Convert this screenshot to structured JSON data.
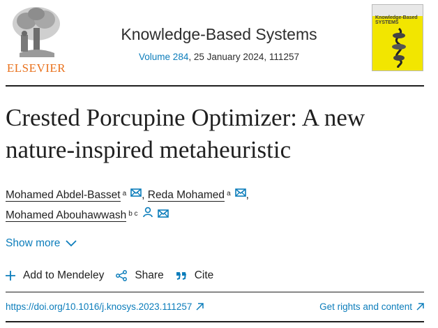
{
  "publisher": {
    "logo_text": "ELSEVIER",
    "logo_icon": "elsevier-tree-logo"
  },
  "journal": {
    "name": "Knowledge-Based Systems",
    "volume_link": "Volume 284",
    "issue_rest": ", 25 January 2024, 111257",
    "cover_title": "Knowledge-Based SYSTEMS"
  },
  "article": {
    "title": "Crested Porcupine Optimizer: A new nature-inspired metaheuristic",
    "authors": [
      {
        "name": "Mohamed Abdel-Basset",
        "sup": "a",
        "icons": [
          "mail-icon"
        ]
      },
      {
        "name": "Reda Mohamed",
        "sup": "a",
        "icons": [
          "mail-icon"
        ]
      },
      {
        "name": "Mohamed Abouhawwash",
        "sup": "b c",
        "icons": [
          "person-icon",
          "mail-icon"
        ]
      }
    ],
    "separator": ","
  },
  "show_more": {
    "label": "Show more",
    "icon": "chevron-down-icon"
  },
  "actions": [
    {
      "label": "Add to Mendeley",
      "icon": "plus-icon"
    },
    {
      "label": "Share",
      "icon": "share-icon"
    },
    {
      "label": "Cite",
      "icon": "quote-icon"
    }
  ],
  "links": {
    "doi": "https://doi.org/10.1016/j.knosys.2023.111257",
    "rights": "Get rights and content",
    "external_icon": "external-arrow-icon"
  },
  "colors": {
    "link": "#0c7dbb",
    "text": "#1f1f1f",
    "elsevier_orange": "#e9711c",
    "cover_yellow": "#f2e600"
  }
}
